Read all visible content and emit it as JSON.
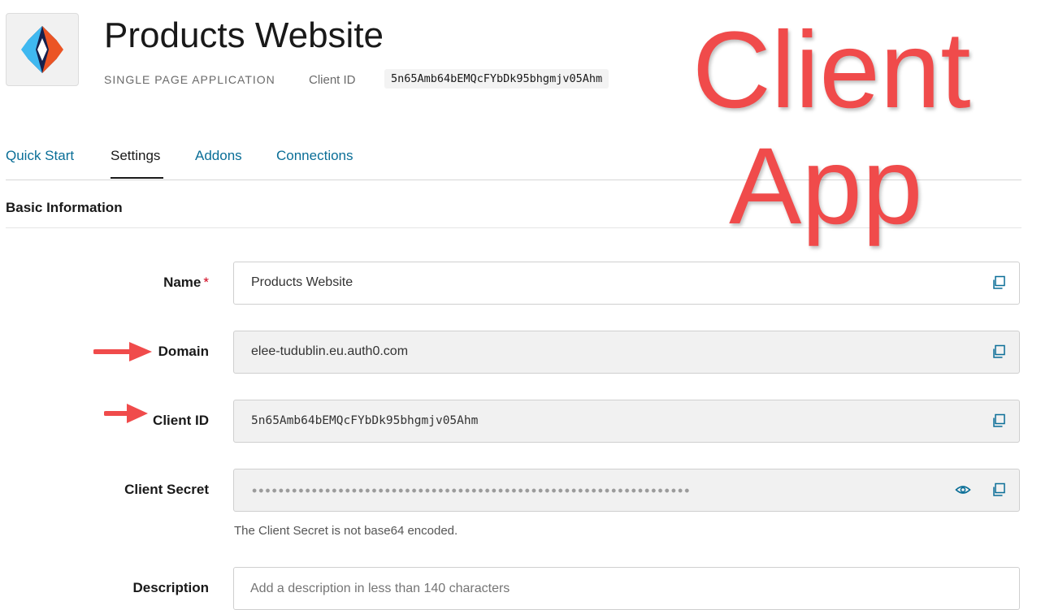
{
  "header": {
    "app_title": "Products Website",
    "app_type": "SINGLE PAGE APPLICATION",
    "client_id_label": "Client ID",
    "client_id_value": "5n65Amb64bEMQcFYbDk95bhgmjv05Ahm"
  },
  "tabs": [
    {
      "label": "Quick Start",
      "active": false
    },
    {
      "label": "Settings",
      "active": true
    },
    {
      "label": "Addons",
      "active": false
    },
    {
      "label": "Connections",
      "active": false
    }
  ],
  "section": {
    "title": "Basic Information"
  },
  "fields": {
    "name": {
      "label": "Name",
      "required_mark": "*",
      "value": "Products Website"
    },
    "domain": {
      "label": "Domain",
      "value": "elee-tudublin.eu.auth0.com"
    },
    "client_id": {
      "label": "Client ID",
      "value": "5n65Amb64bEMQcFYbDk95bhgmjv05Ahm"
    },
    "client_secret": {
      "label": "Client Secret",
      "helper": "The Client Secret is not base64 encoded."
    },
    "description": {
      "label": "Description",
      "placeholder": "Add a description in less than 140 characters"
    }
  },
  "annotation": {
    "line1": "Client",
    "line2": "App",
    "color": "#f04b4b"
  },
  "colors": {
    "link": "#0a6e97",
    "accent_orange": "#eb5424",
    "accent_blue": "#3fb8f0",
    "logo_dark": "#16214d"
  },
  "icons": [
    "copy-icon",
    "eye-icon",
    "arrow-right-icon"
  ]
}
